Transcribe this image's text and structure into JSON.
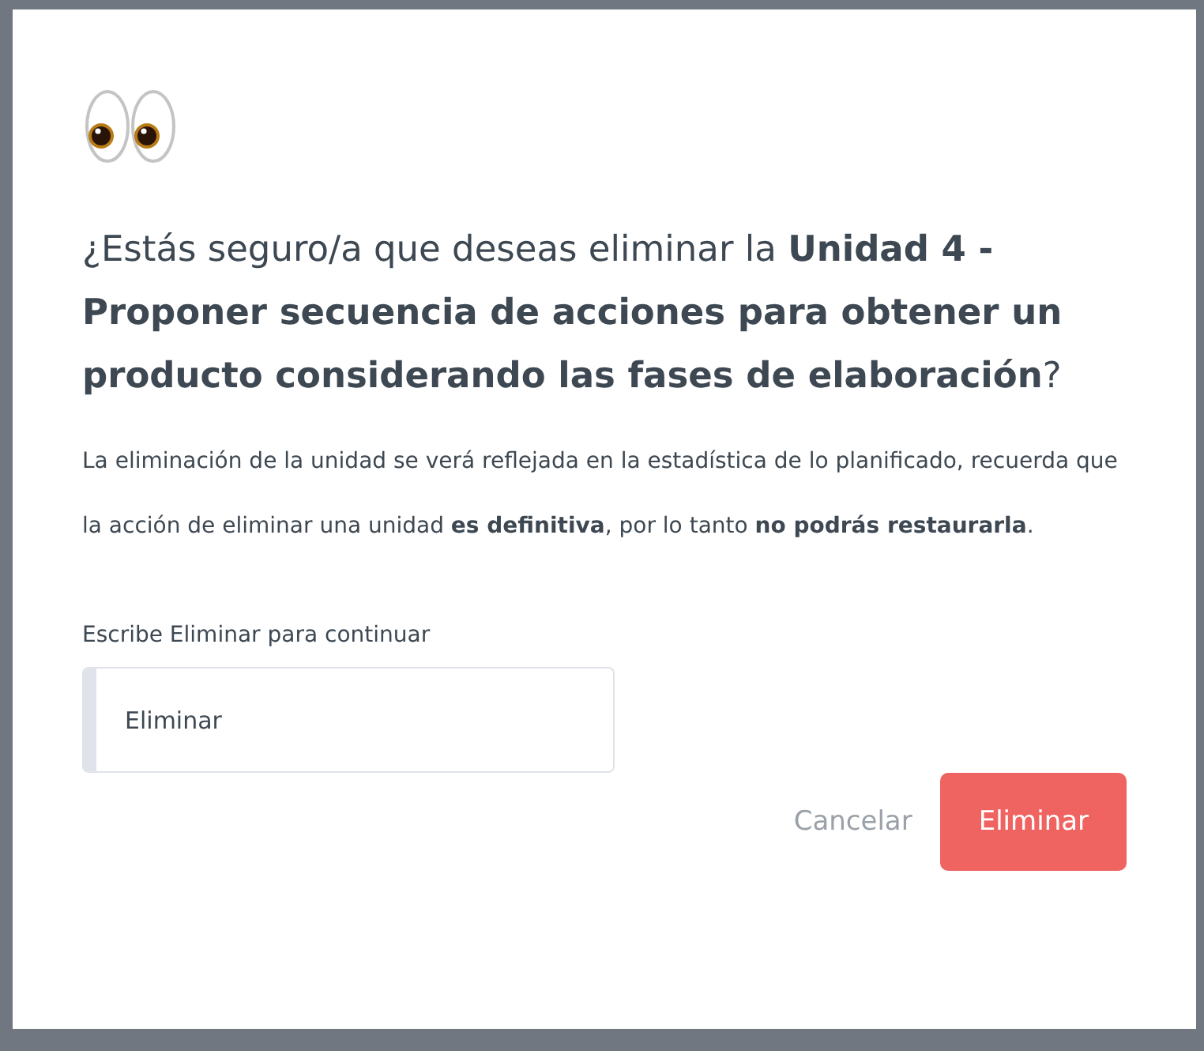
{
  "dialog": {
    "title": "¿Estás seguro/a que deseas eliminar la **Unidad 4 - Proponer secuencia de acciones para obtener un producto considerando las fases de elaboración**?",
    "message": "La eliminación de la unidad se verá reflejada en la estadística de lo planificado, recuerda que la acción de eliminar una unidad **es definitiva**, por lo tanto **no podrás restaurarla**.",
    "confirm_field": {
      "label": "Escribe Eliminar para continuar",
      "value": "Eliminar"
    },
    "buttons": [
      {
        "kind": "secondary",
        "label": "Cancelar"
      },
      {
        "kind": "danger",
        "label": "Eliminar"
      }
    ]
  }
}
